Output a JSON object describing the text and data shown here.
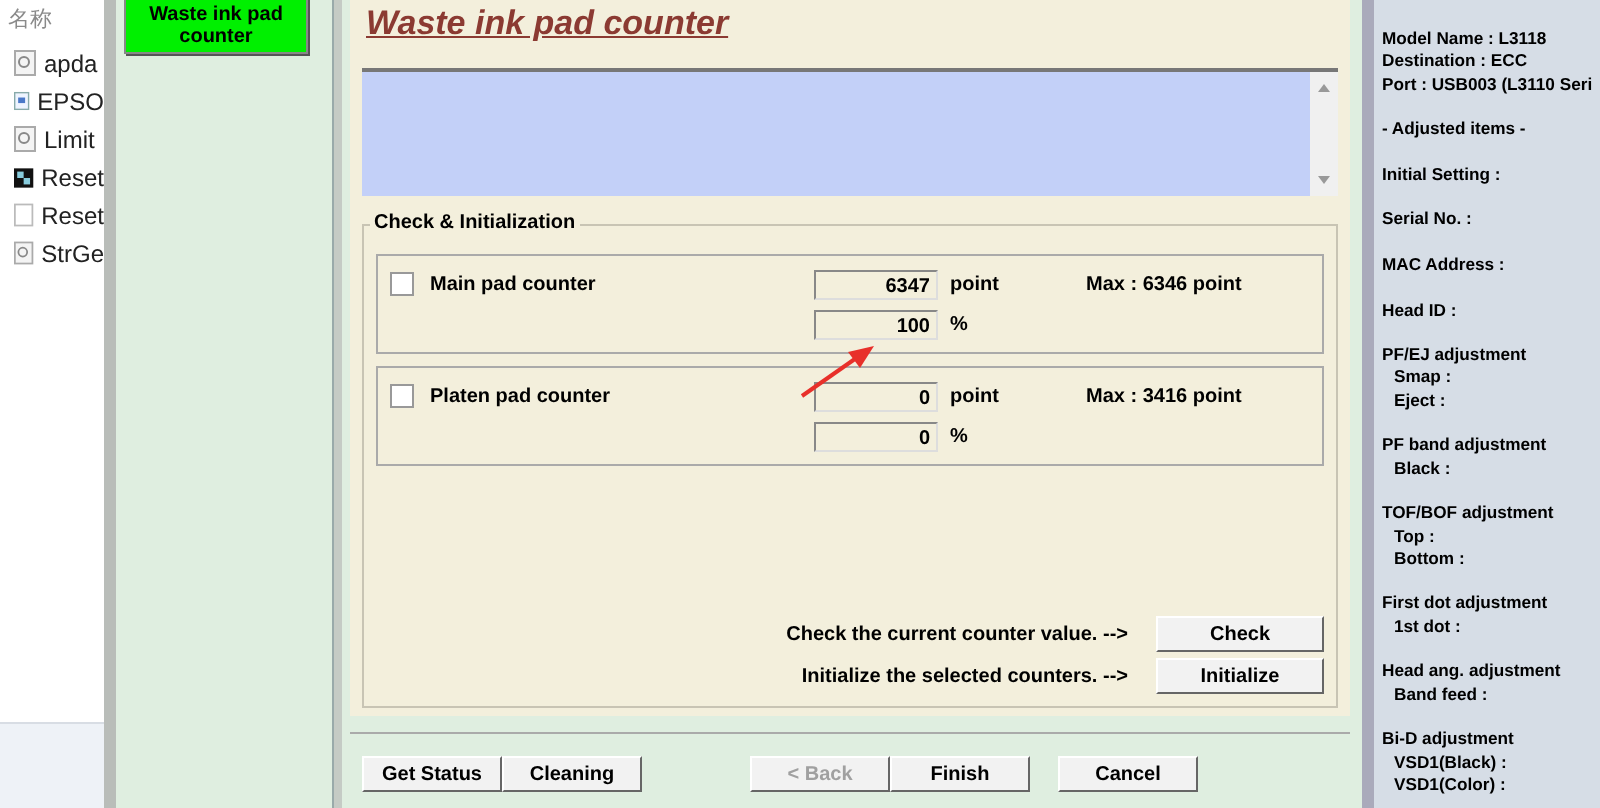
{
  "explorer": {
    "header": "名称",
    "files": [
      {
        "name": "apda",
        "kind": "doc"
      },
      {
        "name": "EPSO",
        "kind": "app"
      },
      {
        "name": "Limit",
        "kind": "doc"
      },
      {
        "name": "Reset",
        "kind": "exe"
      },
      {
        "name": "Reset",
        "kind": "blank"
      },
      {
        "name": "StrGe",
        "kind": "doc"
      }
    ]
  },
  "nav": {
    "items": [
      {
        "label": "Waste ink pad counter",
        "selected": true
      }
    ]
  },
  "title": "Waste ink pad counter",
  "group": {
    "title": "Check & Initialization",
    "counters": [
      {
        "label": "Main pad counter",
        "checked": false,
        "points": "6347",
        "point_unit": "point",
        "max": "Max : 6346 point",
        "percent": "100",
        "percent_unit": "%"
      },
      {
        "label": "Platen pad counter",
        "checked": false,
        "points": "0",
        "point_unit": "point",
        "max": "Max : 3416 point",
        "percent": "0",
        "percent_unit": "%"
      }
    ]
  },
  "actions": [
    {
      "prompt": "Check the current counter value. -->",
      "button": "Check"
    },
    {
      "prompt": "Initialize the selected counters. -->",
      "button": "Initialize"
    }
  ],
  "button_groups": [
    [
      {
        "label": "Get Status",
        "disabled": false
      },
      {
        "label": "Cleaning",
        "disabled": false
      }
    ],
    [
      {
        "label": "< Back",
        "disabled": true
      },
      {
        "label": "Finish",
        "disabled": false
      }
    ],
    [
      {
        "label": "Cancel",
        "disabled": false
      }
    ]
  ],
  "info": {
    "blocks": [
      [
        {
          "text": "Model Name : L3118",
          "kind": "head"
        },
        {
          "text": "Destination : ECC",
          "kind": "head"
        },
        {
          "text": "Port : USB003 (L3110 Seri",
          "kind": "head"
        }
      ],
      [
        {
          "text": "- Adjusted items -",
          "kind": "head"
        }
      ],
      [
        {
          "text": "Initial Setting :",
          "kind": "head"
        }
      ],
      [
        {
          "text": "Serial No. :",
          "kind": "head"
        }
      ],
      [
        {
          "text": "MAC Address :",
          "kind": "head"
        }
      ],
      [
        {
          "text": "Head ID :",
          "kind": "head"
        }
      ],
      [
        {
          "text": "PF/EJ adjustment",
          "kind": "head"
        },
        {
          "text": "Smap :",
          "kind": "sub"
        },
        {
          "text": "Eject :",
          "kind": "sub"
        }
      ],
      [
        {
          "text": "PF band adjustment",
          "kind": "head"
        },
        {
          "text": "Black :",
          "kind": "sub"
        }
      ],
      [
        {
          "text": "TOF/BOF adjustment",
          "kind": "head"
        },
        {
          "text": "Top :",
          "kind": "sub"
        },
        {
          "text": "Bottom :",
          "kind": "sub"
        }
      ],
      [
        {
          "text": "First dot adjustment",
          "kind": "head"
        },
        {
          "text": "1st dot :",
          "kind": "sub"
        }
      ],
      [
        {
          "text": "Head ang. adjustment",
          "kind": "head"
        },
        {
          "text": "Band feed :",
          "kind": "sub"
        }
      ],
      [
        {
          "text": "Bi-D adjustment",
          "kind": "head"
        },
        {
          "text": "VSD1(Black) :",
          "kind": "sub"
        },
        {
          "text": "VSD1(Color) :",
          "kind": "sub"
        }
      ]
    ]
  }
}
